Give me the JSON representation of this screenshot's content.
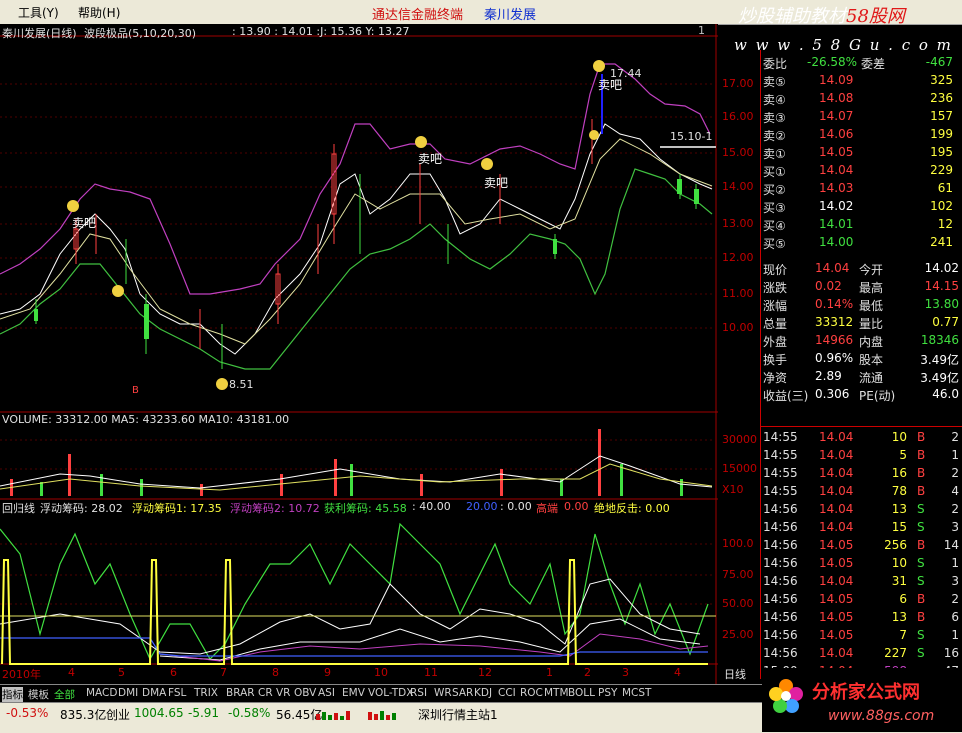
{
  "menu": {
    "tools": "工具(Y)",
    "help": "帮助(H)",
    "app_title": "通达信金融终端",
    "stock_title": "秦川发展",
    "watermark_a": "炒股辅助教材",
    "watermark_b": "58股网",
    "url": "w w w . 5 8 G u . c o m"
  },
  "main_chart": {
    "title": "秦川发展(日线)",
    "indicator": "波段极品(5,10,20,30)",
    "readout": ": 13.90 : 14.01  :J: 15.36  Y: 13.27",
    "y_ticks": [
      "17.00",
      "16.00",
      "15.00",
      "14.00",
      "13.00",
      "12.00",
      "11.00",
      "10.00"
    ],
    "label_high": "17.44",
    "label_low": "8.51",
    "label_cur": "15.10-1",
    "sell_labels": [
      "卖吧",
      "卖吧",
      "卖吧",
      "卖吧",
      "卖吧"
    ],
    "buy_label": "B",
    "top_tick": "1"
  },
  "volume_chart": {
    "header": "VOLUME: 33312.00  MA5: 43233.60  MA10: 43181.00",
    "y_ticks": [
      "30000",
      "15000"
    ],
    "unit": "X10"
  },
  "indicator_chart": {
    "h1": "回归线",
    "h2": "浮动筹码: 28.02",
    "h3": "浮动筹码1: 17.35",
    "h4": "浮动筹码2: 10.72",
    "h5": "获利筹码: 45.58",
    "h6": ": 40.00",
    "h7": "20.00",
    "h8": ": 0.00",
    "h9": "高端",
    "h10": "0.00",
    "h11": "绝地反击: 0.00",
    "y_ticks": [
      "100.0",
      "75.00",
      "50.00",
      "25.00"
    ],
    "colors": {
      "green": "#40e040",
      "white": "#e0e0e0",
      "yellow": "#ffff40",
      "magenta": "#c040c0",
      "blue": "#4060ff"
    }
  },
  "date_axis": {
    "year": "2010年",
    "months": [
      "4",
      "5",
      "6",
      "7",
      "8",
      "9",
      "10",
      "11",
      "12",
      "1",
      "2",
      "3",
      "4"
    ],
    "period": "日线"
  },
  "quote": {
    "weibi_label": "委比",
    "weibi": "-26.58%",
    "weicha_label": "委差",
    "weicha": "-467",
    "asks": [
      {
        "label": "卖⑤",
        "price": "14.09",
        "vol": "325"
      },
      {
        "label": "卖④",
        "price": "14.08",
        "vol": "236"
      },
      {
        "label": "卖③",
        "price": "14.07",
        "vol": "157"
      },
      {
        "label": "卖②",
        "price": "14.06",
        "vol": "199"
      },
      {
        "label": "卖①",
        "price": "14.05",
        "vol": "195"
      }
    ],
    "bids": [
      {
        "label": "买①",
        "price": "14.04",
        "vol": "229"
      },
      {
        "label": "买②",
        "price": "14.03",
        "vol": "61"
      },
      {
        "label": "买③",
        "price": "14.02",
        "vol": "102"
      },
      {
        "label": "买④",
        "price": "14.01",
        "vol": "12"
      },
      {
        "label": "买⑤",
        "price": "14.00",
        "vol": "241"
      }
    ],
    "stats": [
      {
        "l1": "现价",
        "v1": "14.04",
        "l2": "今开",
        "v2": "14.02",
        "c1": "#ff4040",
        "c2": "#ffffff"
      },
      {
        "l1": "涨跌",
        "v1": "0.02",
        "l2": "最高",
        "v2": "14.15",
        "c1": "#ff4040",
        "c2": "#ff4040"
      },
      {
        "l1": "涨幅",
        "v1": "0.14%",
        "l2": "最低",
        "v2": "13.80",
        "c1": "#ff4040",
        "c2": "#40e040"
      },
      {
        "l1": "总量",
        "v1": "33312",
        "l2": "量比",
        "v2": "0.77",
        "c1": "#ffff40",
        "c2": "#ffff40"
      },
      {
        "l1": "外盘",
        "v1": "14966",
        "l2": "内盘",
        "v2": "18346",
        "c1": "#ff4040",
        "c2": "#40e040"
      },
      {
        "l1": "换手",
        "v1": "0.96%",
        "l2": "股本",
        "v2": "3.49亿",
        "c1": "#ffffff",
        "c2": "#ffffff"
      },
      {
        "l1": "净资",
        "v1": "2.89",
        "l2": "流通",
        "v2": "3.49亿",
        "c1": "#ffffff",
        "c2": "#ffffff"
      },
      {
        "l1": "收益(三)",
        "v1": "0.306",
        "l2": "PE(动)",
        "v2": "46.0",
        "c1": "#ffffff",
        "c2": "#ffffff"
      }
    ]
  },
  "trades": [
    {
      "t": "14:55",
      "p": "14.04",
      "v": "10",
      "s": "B",
      "n": "2"
    },
    {
      "t": "14:55",
      "p": "14.04",
      "v": "5",
      "s": "B",
      "n": "1"
    },
    {
      "t": "14:55",
      "p": "14.04",
      "v": "16",
      "s": "B",
      "n": "2"
    },
    {
      "t": "14:55",
      "p": "14.04",
      "v": "78",
      "s": "B",
      "n": "4"
    },
    {
      "t": "14:56",
      "p": "14.04",
      "v": "13",
      "s": "S",
      "n": "2"
    },
    {
      "t": "14:56",
      "p": "14.04",
      "v": "15",
      "s": "S",
      "n": "3"
    },
    {
      "t": "14:56",
      "p": "14.05",
      "v": "256",
      "s": "B",
      "n": "14"
    },
    {
      "t": "14:56",
      "p": "14.05",
      "v": "10",
      "s": "S",
      "n": "1"
    },
    {
      "t": "14:56",
      "p": "14.04",
      "v": "31",
      "s": "S",
      "n": "3"
    },
    {
      "t": "14:56",
      "p": "14.05",
      "v": "6",
      "s": "B",
      "n": "2"
    },
    {
      "t": "14:56",
      "p": "14.05",
      "v": "13",
      "s": "B",
      "n": "6"
    },
    {
      "t": "14:56",
      "p": "14.05",
      "v": "7",
      "s": "S",
      "n": "1"
    },
    {
      "t": "14:56",
      "p": "14.04",
      "v": "227",
      "s": "S",
      "n": "16"
    },
    {
      "t": "15:00",
      "p": "14.04",
      "v": "598",
      "s": "",
      "n": "47"
    }
  ],
  "tabs": [
    "指标",
    "模板",
    "全部",
    "MACD",
    "DMI",
    "DMA",
    "FSL",
    "TRIX",
    "BRAR",
    "CR",
    "VR",
    "OBV",
    "ASI",
    "EMV",
    "VOL-TDX",
    "RSI",
    "WR",
    "SAR",
    "KDJ",
    "CCI",
    "ROC",
    "MTM",
    "BOLL",
    "PSY",
    "MCST"
  ],
  "status": {
    "sh": "-0.53%",
    "sh_amt": "835.3亿",
    "cy_label": "创业",
    "cy": "1004.65",
    "cy_chg": "-5.91",
    "cy_pct": "-0.58%",
    "cy_amt": "56.45亿",
    "server": "深圳行情主站1"
  },
  "logo": {
    "name": "分析家公式网",
    "url": "www.88gs.com"
  }
}
